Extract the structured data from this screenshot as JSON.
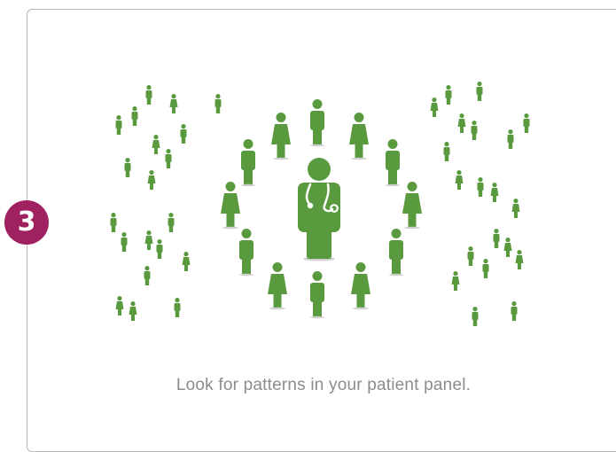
{
  "step": {
    "number": "3"
  },
  "caption": {
    "text": "Look for patterns in your patient panel."
  },
  "colors": {
    "accent": "#a0215f",
    "figure_green": "#5a9a3e",
    "card_border": "#b9b9b9",
    "caption_text": "#8c8c8c"
  },
  "illustration": {
    "center_figure": "doctor-with-stethoscope-icon",
    "ring_figures": "person-icon",
    "scattered_figures": "person-icon"
  }
}
